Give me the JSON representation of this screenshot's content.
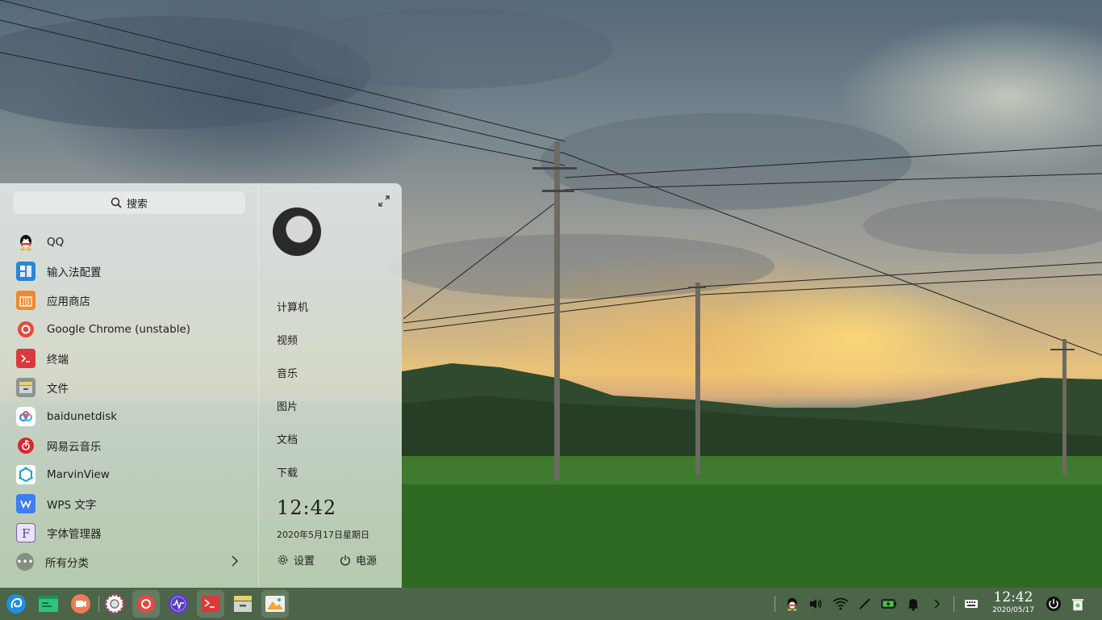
{
  "launcher": {
    "search_placeholder": "搜索",
    "apps": [
      {
        "label": "QQ",
        "icon": "qq-icon"
      },
      {
        "label": "输入法配置",
        "icon": "input-method-icon"
      },
      {
        "label": "应用商店",
        "icon": "app-store-icon"
      },
      {
        "label": "Google Chrome (unstable)",
        "icon": "chrome-icon"
      },
      {
        "label": "终端",
        "icon": "terminal-icon"
      },
      {
        "label": "文件",
        "icon": "file-manager-icon"
      },
      {
        "label": "baidunetdisk",
        "icon": "baidunetdisk-icon"
      },
      {
        "label": "网易云音乐",
        "icon": "netease-music-icon"
      },
      {
        "label": "MarvinView",
        "icon": "marvinview-icon"
      },
      {
        "label": "WPS 文字",
        "icon": "wps-writer-icon"
      },
      {
        "label": "字体管理器",
        "icon": "font-manager-icon"
      }
    ],
    "all_categories": "所有分类",
    "places": [
      "计算机",
      "视频",
      "音乐",
      "图片",
      "文档",
      "下载"
    ],
    "clock": "12:42",
    "date": "2020年5月17日星期日",
    "settings_label": "设置",
    "power_label": "电源"
  },
  "dock": {
    "apps": [
      "launcher-icon",
      "deepin-terminal-icon",
      "screen-recorder-icon",
      "settings-icon",
      "chrome-icon",
      "system-monitor-icon",
      "terminal-icon",
      "file-manager-icon",
      "image-viewer-icon"
    ],
    "time": "12:42",
    "date": "2020/05/17"
  },
  "colors": {
    "dock_bg": "#486244",
    "chrome_red": "#e34b3e",
    "terminal_red": "#d93a3a",
    "accent_blue": "#2a86d6"
  }
}
